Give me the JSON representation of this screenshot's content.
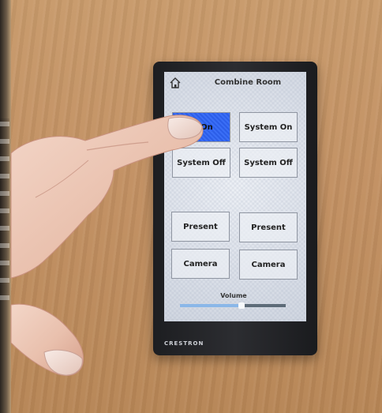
{
  "panel": {
    "title": "Combine Room",
    "icon": "home-icon",
    "brand": "CRESTRON",
    "buttons": [
      {
        "label": "System On",
        "visible_label": "m On",
        "active": true
      },
      {
        "label": "System On",
        "active": false
      },
      {
        "label": "System Off",
        "active": false
      },
      {
        "label": "System Off",
        "active": false
      },
      {
        "label": "Present",
        "active": false
      },
      {
        "label": "Present",
        "active": false
      },
      {
        "label": "Camera",
        "active": false
      },
      {
        "label": "Camera",
        "active": false
      }
    ],
    "volume": {
      "label": "Volume",
      "level": 0.58
    },
    "colors": {
      "active_button": "#3366ee",
      "volume_fill": "#8ab7e8"
    }
  }
}
